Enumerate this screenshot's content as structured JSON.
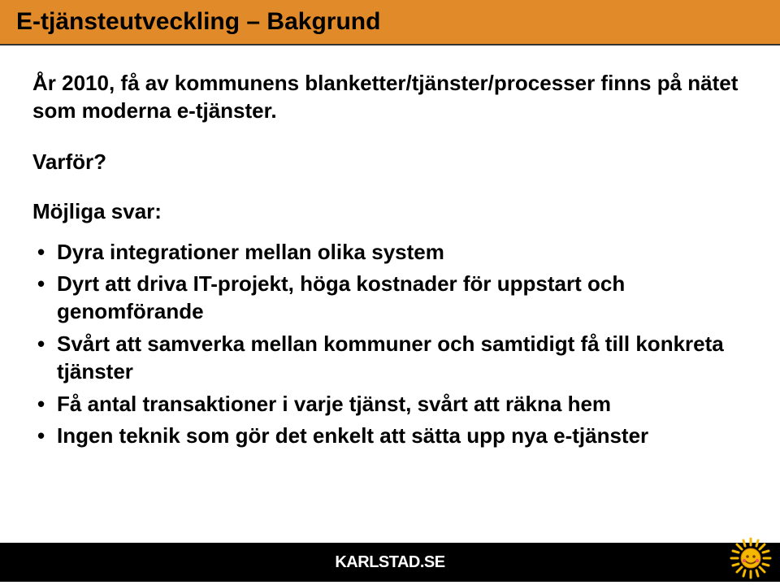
{
  "header": {
    "title": "E-tjänsteutveckling – Bakgrund"
  },
  "intro": "År 2010, få av kommunens blanketter/tjänster/processer finns på nätet som moderna e-tjänster.",
  "varfor": "Varför?",
  "subhead": "Möjliga svar:",
  "bullets": [
    "Dyra integrationer mellan olika system",
    "Dyrt att driva IT-projekt, höga kostnader för uppstart och genomförande",
    "Svårt att samverka mellan kommuner och samtidigt få till konkreta tjänster",
    "Få antal transaktioner i varje tjänst, svårt att räkna hem",
    "Ingen teknik som gör det enkelt att sätta upp nya e-tjänster"
  ],
  "footer": {
    "brand_main": "KARLSTAD",
    "brand_suffix": ".SE"
  }
}
